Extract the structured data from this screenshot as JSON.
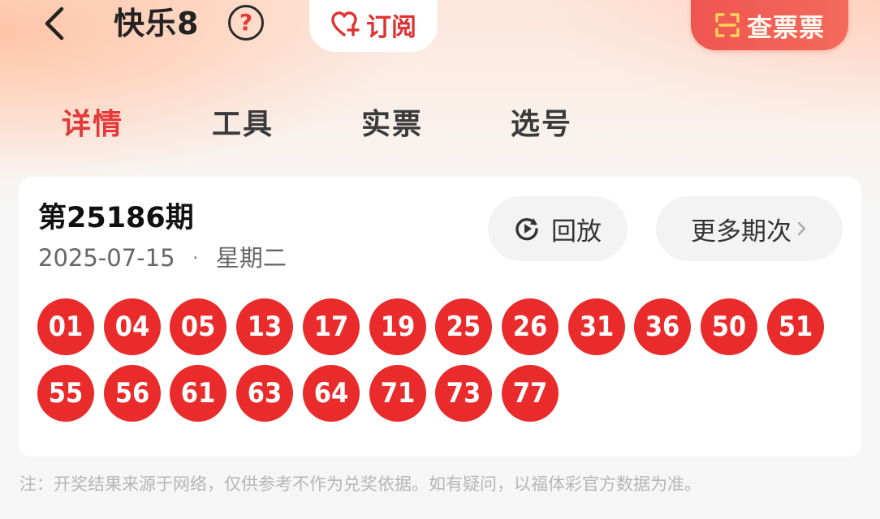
{
  "header": {
    "title": "快乐8",
    "help_label": "?",
    "subscribe_label": "订阅",
    "check_ticket_label": "查票票"
  },
  "tabs": [
    {
      "label": "详情",
      "active": true
    },
    {
      "label": "工具",
      "active": false
    },
    {
      "label": "实票",
      "active": false
    },
    {
      "label": "选号",
      "active": false
    }
  ],
  "draw": {
    "issue": "第25186期",
    "date": "2025-07-15",
    "separator": "·",
    "weekday": "星期二",
    "replay_label": "回放",
    "more_label": "更多期次",
    "numbers": [
      "01",
      "04",
      "05",
      "13",
      "17",
      "19",
      "25",
      "26",
      "31",
      "36",
      "50",
      "51",
      "55",
      "56",
      "61",
      "63",
      "64",
      "71",
      "73",
      "77"
    ]
  },
  "footnote": "注：开奖结果来源于网络，仅供参考不作为兑奖依据。如有疑问，以福体彩官方数据为准。",
  "colors": {
    "accent_red": "#e23a3a",
    "ball_red": "#e92b2b",
    "check_ticket_bg": "#ef5550"
  },
  "icons": {
    "back": "chevron-left-icon",
    "help": "question-circle-icon",
    "subscribe": "heart-plus-icon",
    "check_ticket": "scan-icon",
    "replay": "replay-icon",
    "more": "chevron-right-icon"
  }
}
